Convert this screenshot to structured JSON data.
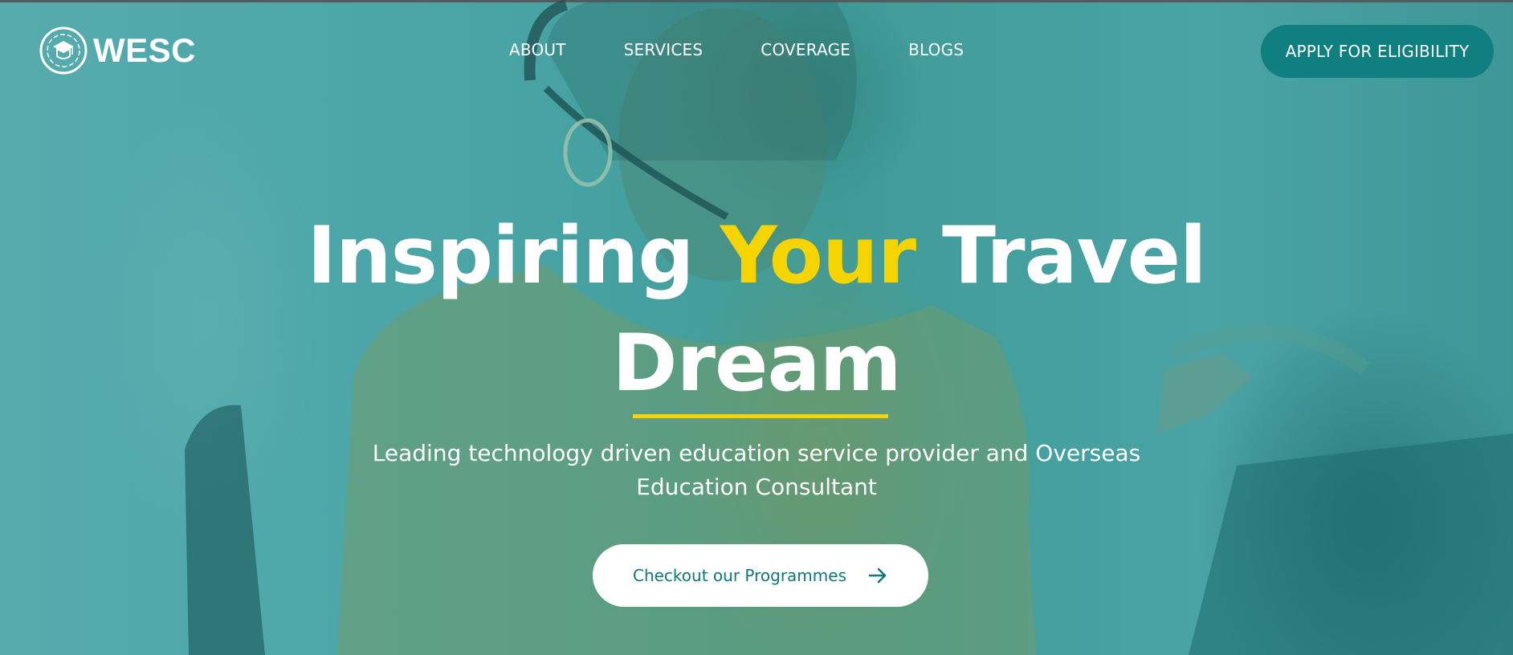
{
  "brand": {
    "name": "WESC",
    "logo_icon": "graduation-cap-shield-icon"
  },
  "nav": {
    "items": [
      {
        "label": "ABOUT"
      },
      {
        "label": "SERVICES"
      },
      {
        "label": "COVERAGE"
      },
      {
        "label": "BLOGS"
      }
    ]
  },
  "header": {
    "cta_label": "APPLY FOR ELIGIBILITY"
  },
  "hero": {
    "headline_part1": "Inspiring ",
    "headline_accent": "Your",
    "headline_part2": " Travel",
    "headline_line2": "Dream",
    "subtitle": "Leading technology driven education service provider and Overseas Education Consultant",
    "cta_label": "Checkout our Programmes",
    "cta_icon": "arrow-right-icon"
  },
  "colors": {
    "overlay_teal": "#3f9d9f",
    "accent_yellow": "#f6d400",
    "button_teal": "#0f7f80",
    "cta_text": "#0f7877",
    "text": "#ffffff"
  }
}
